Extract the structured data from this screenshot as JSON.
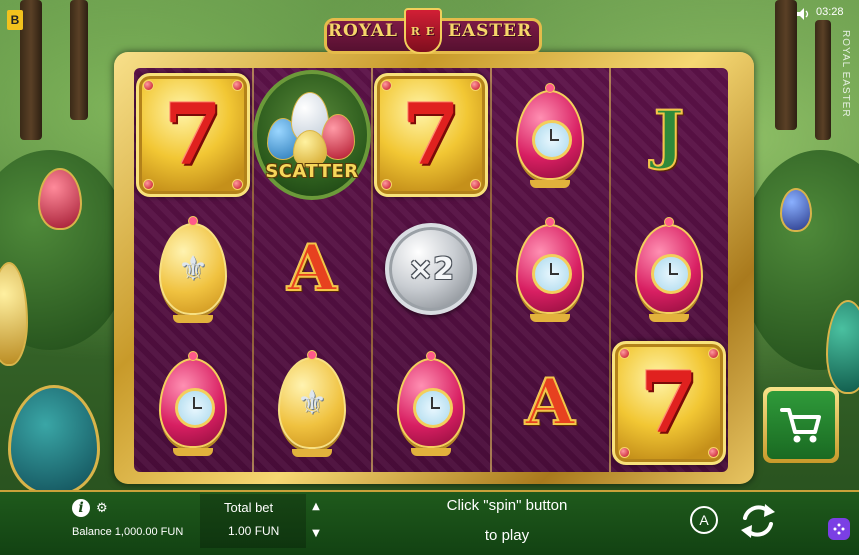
{
  "topbar": {
    "provider_logo": "B",
    "clock": "03:28",
    "vertical_title": "ROYAL EASTER"
  },
  "game_logo": {
    "left_word": "ROYAL",
    "right_word": "EASTER",
    "shield_letters": "R E"
  },
  "reels": {
    "columns": [
      [
        "seven",
        "egg-fleur",
        "egg-clock"
      ],
      [
        "scatter",
        "letter-a",
        "egg-fleur"
      ],
      [
        "seven",
        "multiplier",
        "egg-clock"
      ],
      [
        "egg-clock",
        "egg-clock",
        "letter-a"
      ],
      [
        "letter-j",
        "egg-clock",
        "seven"
      ]
    ],
    "scatter_label": "SCATTER",
    "multiplier_label": "×2",
    "seven_label": "7",
    "a_label": "A",
    "j_label": "J"
  },
  "bottombar": {
    "balance": "Balance 1,000.00 FUN",
    "total_bet_label": "Total bet",
    "total_bet_value": "1.00 FUN",
    "message_line1": "Click \"spin\" button",
    "message_line2": "to play",
    "auto_label": "A",
    "info_label": "i"
  },
  "colors": {
    "frame_gold": "#e5bb4a",
    "reel_bg": "#4a0d3a",
    "bottombar_bg": "#124212",
    "buy_button_green": "#2f9a3a",
    "menu_purple": "#7b3fe4"
  }
}
